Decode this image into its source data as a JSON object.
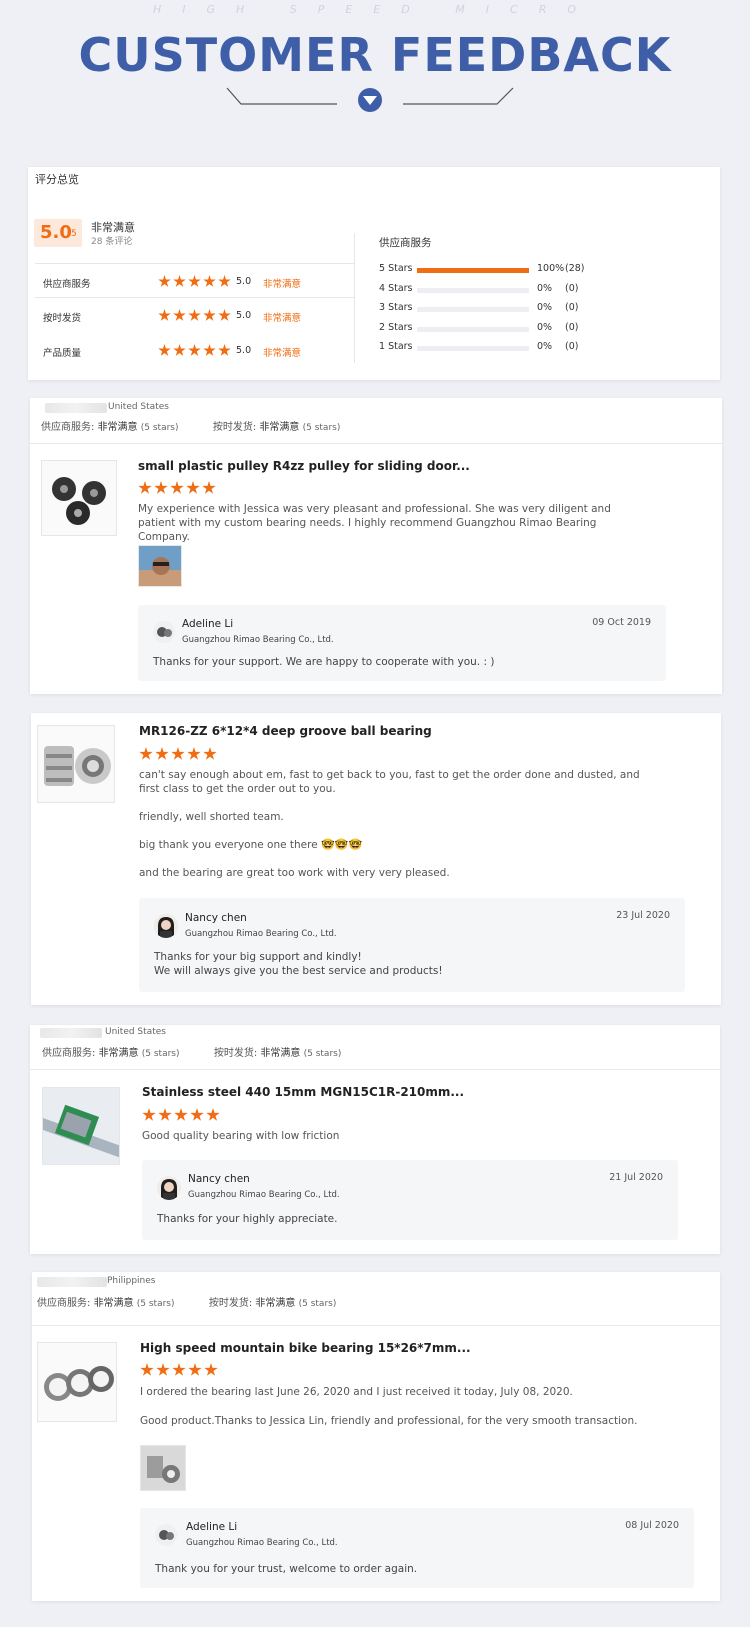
{
  "header": {
    "subtitle": "HIGH SPEED MICRO",
    "title": "CUSTOMER FEEDBACK"
  },
  "summary": {
    "title": "评分总览",
    "score": "5.0",
    "score_suffix": "/5",
    "verdict": "非常满意",
    "review_count": "28 条评论",
    "rows": [
      {
        "label": "供应商服务",
        "score": "5.0",
        "verdict": "非常满意"
      },
      {
        "label": "按时发货",
        "score": "5.0",
        "verdict": "非常满意"
      },
      {
        "label": "产品质量",
        "score": "5.0",
        "verdict": "非常满意"
      }
    ],
    "service_title": "供应商服务",
    "breakdown": [
      {
        "label": "5 Stars",
        "fill": 1.0,
        "pct": "100%",
        "count": "(28)"
      },
      {
        "label": "4 Stars",
        "fill": 0,
        "pct": "0%",
        "count": "(0)"
      },
      {
        "label": "3 Stars",
        "fill": 0,
        "pct": "0%",
        "count": "(0)"
      },
      {
        "label": "2 Stars",
        "fill": 0,
        "pct": "0%",
        "count": "(0)"
      },
      {
        "label": "1 Stars",
        "fill": 0,
        "pct": "0%",
        "count": "(0)"
      }
    ],
    "accent": "#f06d13"
  },
  "review_meta": {
    "service_label": "供应商服务:",
    "ship_label": "按时发货:",
    "verdict": "非常满意",
    "stars_note": "(5 stars)"
  },
  "reviews": [
    {
      "country": "United States",
      "product": "small plastic pulley R4zz pulley for sliding door...",
      "rating": 5,
      "paragraphs": [
        "My experience with Jessica was very pleasant and professional. She was very diligent and patient with my custom bearing needs. I highly recommend Guangzhou Rimao Bearing Company."
      ],
      "reply": {
        "name": "Adeline Li",
        "company": "Guangzhou Rimao Bearing Co., Ltd.",
        "date": "09 Oct 2019",
        "text": "Thanks for your support. We are happy to cooperate with you. : )"
      }
    },
    {
      "product": "MR126-ZZ 6*12*4 deep groove ball bearing",
      "rating": 5,
      "paragraphs": [
        "can't say enough about em, fast to get back to you, fast to get the order done and dusted, and first class to get the order out to you.",
        "friendly, well shorted team.",
        "big thank you everyone one there",
        "and the bearing are great too work with very very pleased."
      ],
      "emoji": "🤓🤓🤓",
      "reply": {
        "name": "Nancy chen",
        "company": "Guangzhou Rimao Bearing Co., Ltd.",
        "date": "23 Jul 2020",
        "text1": "Thanks for your big support and kindly!",
        "text2": "We will always give you the best service and products!"
      }
    },
    {
      "country": "United States",
      "product": "Stainless steel 440 15mm MGN15C1R-210mm...",
      "rating": 5,
      "paragraphs": [
        "Good quality bearing with low friction"
      ],
      "reply": {
        "name": "Nancy chen",
        "company": "Guangzhou Rimao Bearing Co., Ltd.",
        "date": "21 Jul 2020",
        "text": "Thanks for your highly appreciate."
      }
    },
    {
      "country": "Philippines",
      "product": "High speed mountain bike bearing 15*26*7mm...",
      "rating": 5,
      "paragraphs": [
        "I ordered the bearing last June 26, 2020 and I just received it today, July 08, 2020.",
        "Good product.Thanks to Jessica Lin, friendly and professional, for the very smooth transaction."
      ],
      "reply": {
        "name": "Adeline Li",
        "company": "Guangzhou Rimao Bearing Co., Ltd.",
        "date": "08 Jul 2020",
        "text": "Thank you for your trust, welcome to order again."
      }
    }
  ]
}
